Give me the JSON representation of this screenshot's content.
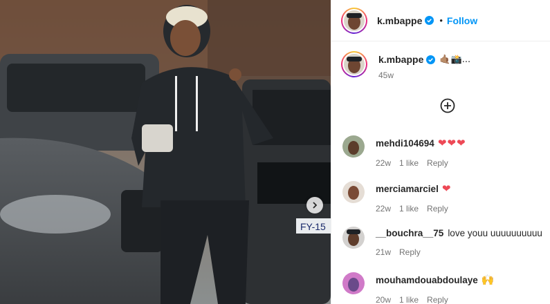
{
  "post": {
    "author": "k.mbappe",
    "follow_label": "Follow",
    "dot": "•",
    "caption_emoji": "🤙🏽📸...",
    "time_ago": "45w",
    "more_comments_icon": "plus-circle-icon",
    "next_icon": "chevron-right-icon"
  },
  "comments": [
    {
      "user": "mehdi104694",
      "text": "",
      "hearts": "❤❤❤",
      "time": "22w",
      "likes": "1 like",
      "reply": "Reply"
    },
    {
      "user": "merciamarciel",
      "text": "",
      "hearts": "❤",
      "time": "22w",
      "likes": "1 like",
      "reply": "Reply"
    },
    {
      "user": "__bouchra__75",
      "text": "love youu uuuuuuuuuu",
      "hearts": "",
      "time": "21w",
      "likes": "",
      "reply": "Reply"
    },
    {
      "user": "mouhamdouabdoulaye",
      "text": "",
      "hearts": "🙌",
      "time": "20w",
      "likes": "1 like",
      "reply": "Reply"
    }
  ],
  "colors": {
    "accent": "#0095f6",
    "heart": "#ed4956",
    "muted": "#737373"
  }
}
